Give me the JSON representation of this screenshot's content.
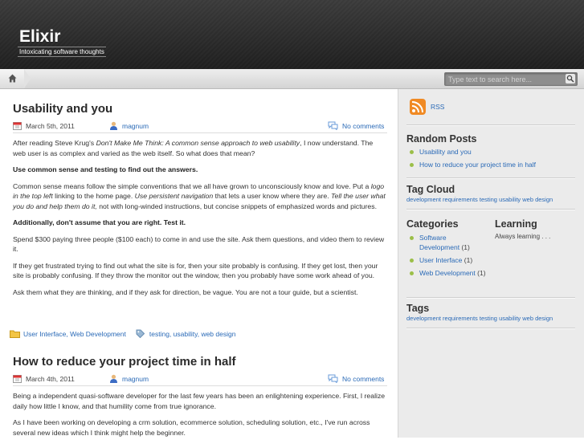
{
  "site": {
    "title": "Elixir",
    "tagline": "Intoxicating software thoughts"
  },
  "search": {
    "placeholder": "Type text to search here..."
  },
  "posts": [
    {
      "title": "Usability and you",
      "date": "March 5th, 2011",
      "author": "magnum",
      "comments": "No comments",
      "body": {
        "p1_a": "After reading Steve Krug's ",
        "p1_em": "Don't Make Me Think: A common sense approach to web usability",
        "p1_b": ", I now understand. The web user is as complex and varied as the web itself. So what does that mean?",
        "h1": "Use common sense and testing to find out the answers.",
        "p2_a": "Common sense means follow the simple conventions that we all have grown to unconsciously know and love. Put a ",
        "p2_em1": "logo in the top left",
        "p2_b": " linking to the home page. ",
        "p2_em2": "Use persistent navigation",
        "p2_c": " that lets a user know where they are. ",
        "p2_em3": "Tell the user what you do and help them do it,",
        "p2_d": " not with long-winded instructions, but concise snippets of emphasized words and pictures.",
        "h2": "Additionally, don't assume that you are right. Test it.",
        "p3": "Spend $300 paying three people ($100 each) to come in and use the site. Ask them questions, and video them to review it.",
        "p4": "If they get frustrated trying to find out what the site is for, then your site probably is confusing. If they get lost, then your site is probably confusing. If they throw the monitor out the window, then you probably have some work ahead of you.",
        "p5": "Ask them what they are thinking, and if they ask for direction, be vague. You are not a tour guide, but a scientist."
      },
      "categories": "User Interface, Web Development",
      "tags": "testing, usability, web design"
    },
    {
      "title": "How to reduce your project time in half",
      "date": "March 4th, 2011",
      "author": "magnum",
      "comments": "No comments",
      "body": {
        "p1": "Being a independent quasi-software developer for the last few years has been an enlightening experience. First, I realize daily how little I know, and that humility come from true ignorance.",
        "p2": "As I have been working on developing a crm solution, ecommerce solution, scheduling solution, etc., I've run across several new ideas which I think might help the beginner."
      }
    }
  ],
  "sidebar": {
    "rss": "RSS",
    "random_posts": {
      "title": "Random Posts",
      "items": [
        "Usability and you",
        "How to reduce your project time in half"
      ]
    },
    "tag_cloud": {
      "title": "Tag Cloud",
      "tags": "development requirements testing usability web design"
    },
    "categories": {
      "title": "Categories",
      "items": [
        {
          "label": "Software Development",
          "count": "(1)"
        },
        {
          "label": "User Interface",
          "count": "(1)"
        },
        {
          "label": "Web Development",
          "count": "(1)"
        }
      ]
    },
    "learning": {
      "title": "Learning",
      "text": "Always learning . . ."
    },
    "tags": {
      "title": "Tags",
      "tags": "development requirements testing usability web design"
    }
  },
  "colors": {
    "link": "#2a6ab7",
    "bullet": "#9bbf48",
    "header_bg": "#262626"
  }
}
